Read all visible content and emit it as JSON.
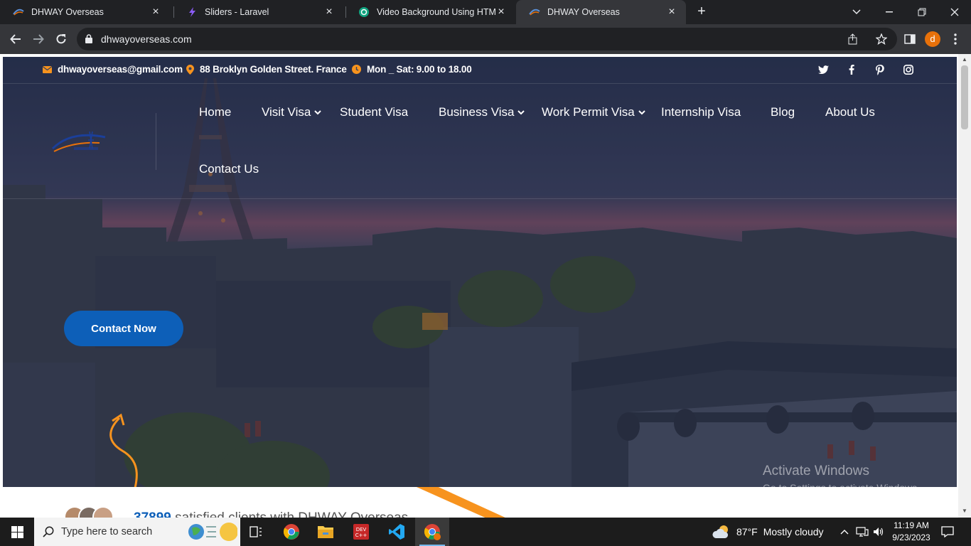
{
  "browser": {
    "tabs": [
      {
        "title": "DHWAY Overseas",
        "active": false
      },
      {
        "title": "Sliders - Laravel",
        "active": false
      },
      {
        "title": "Video Background Using HTML5",
        "active": false
      },
      {
        "title": "DHWAY Overseas",
        "active": true
      }
    ],
    "url": "dhwayoverseas.com",
    "profile_initial": "d"
  },
  "topbar": {
    "email": "dhwayoverseas@gmail.com",
    "address": "88 Broklyn Golden Street. France",
    "hours": "Mon _ Sat: 9.00 to 18.00",
    "social": [
      "twitter-icon",
      "facebook-icon",
      "pinterest-icon",
      "instagram-icon"
    ]
  },
  "nav": {
    "items": [
      {
        "label": "Home",
        "dropdown": false
      },
      {
        "label": "Visit Visa",
        "dropdown": true
      },
      {
        "label": "Student Visa",
        "dropdown": false
      },
      {
        "label": "Business Visa",
        "dropdown": true
      },
      {
        "label": "Work Permit Visa",
        "dropdown": true
      },
      {
        "label": "Internship Visa",
        "dropdown": false
      },
      {
        "label": "Blog",
        "dropdown": false
      },
      {
        "label": "About Us",
        "dropdown": false
      },
      {
        "label": "Contact Us",
        "dropdown": false
      }
    ]
  },
  "hero": {
    "cta_label": "Contact Now",
    "stat_number": "37899",
    "stat_text": " satisfied clients with DHWAY Overseas"
  },
  "watermark": {
    "line1": "Activate Windows",
    "line2": "Go to Settings to activate Windows."
  },
  "taskbar": {
    "search_placeholder": "Type here to search",
    "weather_temp": "87°F",
    "weather_desc": "Mostly cloudy",
    "time": "11:19 AM",
    "date": "9/23/2023"
  },
  "colors": {
    "brand_blue": "#0d5fb8",
    "accent_orange": "#f7931e"
  }
}
